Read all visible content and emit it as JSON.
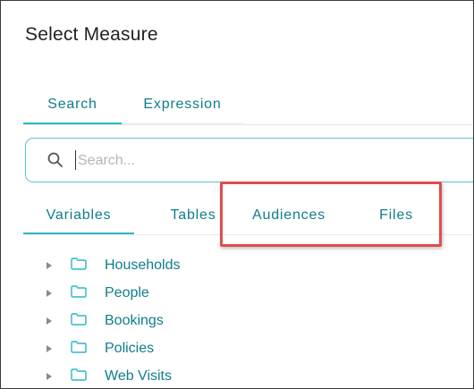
{
  "dialog": {
    "title": "Select Measure"
  },
  "search_tabs": [
    {
      "label": "Search",
      "active": true
    },
    {
      "label": "Expression",
      "active": false
    }
  ],
  "search": {
    "value": "",
    "placeholder": "Search...",
    "icon": "search-icon"
  },
  "category_tabs": [
    {
      "label": "Variables",
      "active": true
    },
    {
      "label": "Tables",
      "active": false
    },
    {
      "label": "Audiences",
      "active": false
    },
    {
      "label": "Files",
      "active": false
    }
  ],
  "tree": {
    "items": [
      {
        "label": "Households",
        "icon": "folder-icon",
        "expanded": false
      },
      {
        "label": "People",
        "icon": "folder-icon",
        "expanded": false
      },
      {
        "label": "Bookings",
        "icon": "folder-icon",
        "expanded": false
      },
      {
        "label": "Policies",
        "icon": "folder-icon",
        "expanded": false
      },
      {
        "label": "Web Visits",
        "icon": "folder-icon",
        "expanded": false
      }
    ]
  },
  "colors": {
    "accent": "#2bb7c8",
    "link_text": "#0f7d8c",
    "highlight_box": "#e14d4d",
    "search_border": "#5cc3cf"
  }
}
